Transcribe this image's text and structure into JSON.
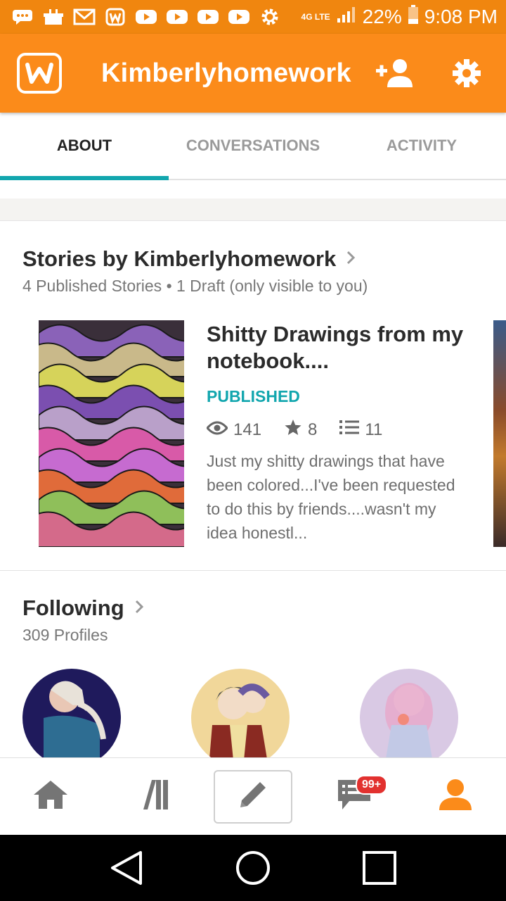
{
  "status_bar": {
    "network": "4G LTE",
    "battery": "22%",
    "time": "9:08 PM",
    "left_icons": [
      "chat-icon",
      "cake-icon",
      "gmail-icon",
      "wattpad-icon",
      "youtube-icon",
      "youtube-icon",
      "youtube-icon",
      "youtube-icon",
      "settings-icon"
    ]
  },
  "app_bar": {
    "title": "Kimberlyhomework",
    "logo": "wattpad-logo-icon",
    "actions": [
      "add-user-icon",
      "gear-icon"
    ],
    "color": "#fb8b1a"
  },
  "tabs": [
    {
      "label": "ABOUT",
      "active": true
    },
    {
      "label": "CONVERSATIONS",
      "active": false
    },
    {
      "label": "ACTIVITY",
      "active": false
    }
  ],
  "stories": {
    "heading": "Stories by Kimberlyhomework",
    "subtitle": "4 Published Stories • 1 Draft (only visible to you)",
    "items": [
      {
        "title": "Shitty Drawings from my notebook....",
        "status": "PUBLISHED",
        "views": "141",
        "votes": "8",
        "parts": "11",
        "description": "Just my shitty drawings that have been colored...I've been requested to do this by friends....wasn't my idea honestl..."
      }
    ]
  },
  "following": {
    "heading": "Following",
    "subtitle": "309 Profiles"
  },
  "bottom_nav": {
    "items": [
      "home-icon",
      "library-icon",
      "write-icon",
      "messages-icon",
      "profile-icon"
    ],
    "messages_badge": "99+"
  },
  "colors": {
    "accent": "#12a6ae",
    "brand": "#fb8b1a",
    "badge": "#e2312f"
  }
}
